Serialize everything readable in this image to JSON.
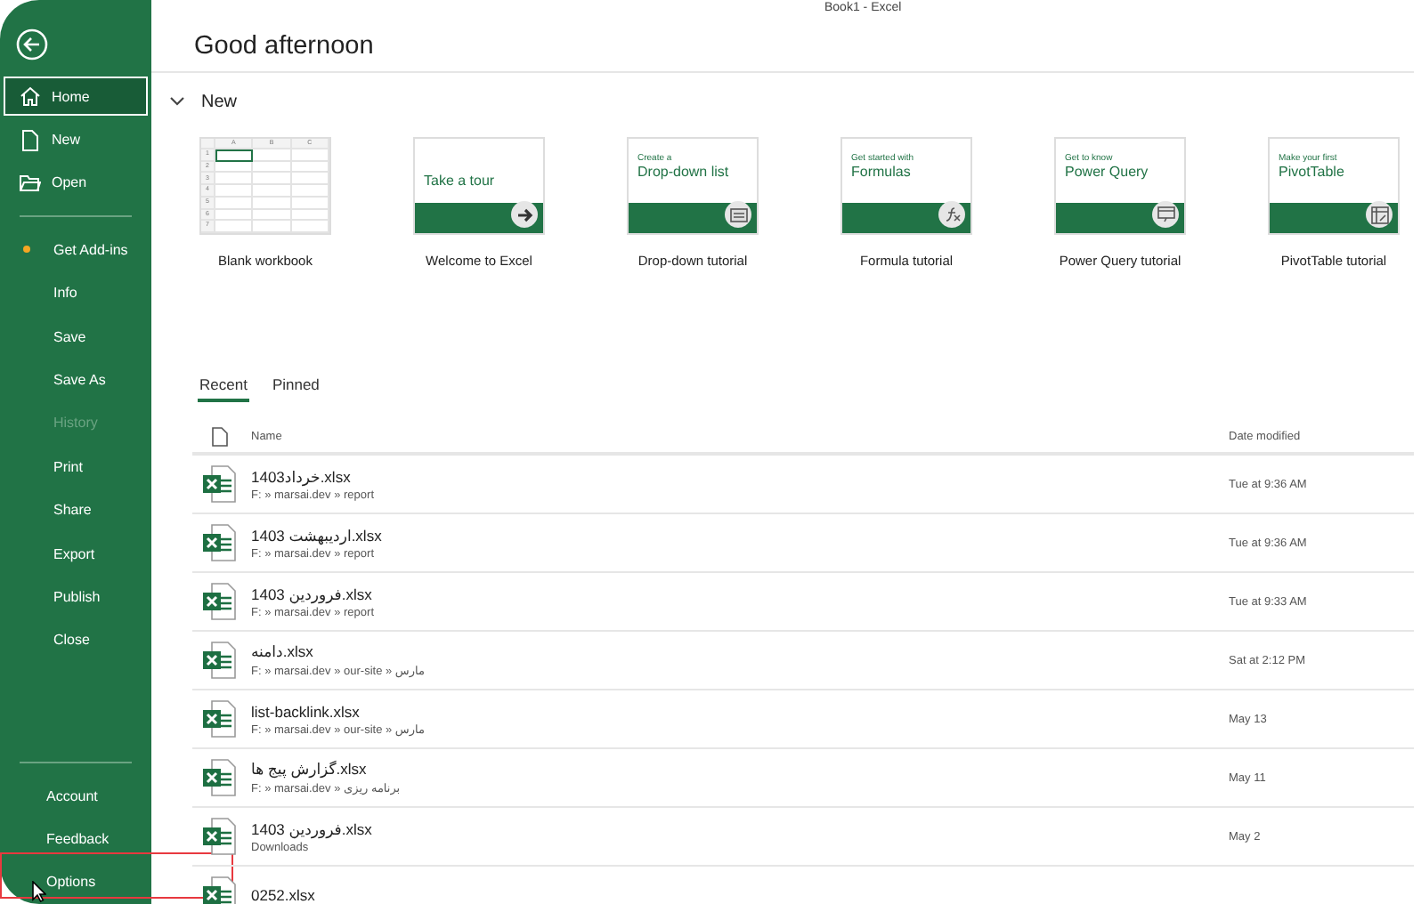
{
  "window": {
    "title": "Book1 - Excel"
  },
  "sidebar": {
    "top_items": [
      {
        "label": "Home",
        "selected": true,
        "disabled": false,
        "kind": "home"
      },
      {
        "label": "New",
        "selected": false,
        "disabled": false,
        "kind": "new"
      },
      {
        "label": "Open",
        "selected": false,
        "disabled": false,
        "kind": "open"
      }
    ],
    "middle_items": [
      {
        "label": "Get Add-ins",
        "selected": false,
        "disabled": false,
        "dot": true
      },
      {
        "label": "Info",
        "selected": false,
        "disabled": false,
        "dot": false
      },
      {
        "label": "Save",
        "selected": false,
        "disabled": false,
        "dot": false
      },
      {
        "label": "Save As",
        "selected": false,
        "disabled": false,
        "dot": false
      },
      {
        "label": "History",
        "selected": false,
        "disabled": true,
        "dot": false
      },
      {
        "label": "Print",
        "selected": false,
        "disabled": false,
        "dot": false
      },
      {
        "label": "Share",
        "selected": false,
        "disabled": false,
        "dot": false
      },
      {
        "label": "Export",
        "selected": false,
        "disabled": false,
        "dot": false
      },
      {
        "label": "Publish",
        "selected": false,
        "disabled": false,
        "dot": false
      },
      {
        "label": "Close",
        "selected": false,
        "disabled": false,
        "dot": false
      }
    ],
    "bottom_items": [
      {
        "label": "Account",
        "selected": false,
        "disabled": false,
        "highlighted": false
      },
      {
        "label": "Feedback",
        "selected": false,
        "disabled": false,
        "highlighted": false
      },
      {
        "label": "Options",
        "selected": false,
        "disabled": false,
        "highlighted": true
      }
    ]
  },
  "greeting": "Good afternoon",
  "new_section": {
    "title": "New",
    "templates": [
      {
        "kind": "blank",
        "label": "Blank workbook",
        "columns": [
          "A",
          "B",
          "C"
        ],
        "rows": [
          "1",
          "2",
          "3",
          "4",
          "5",
          "6",
          "7"
        ]
      },
      {
        "kind": "tour",
        "label": "Welcome to Excel",
        "heading": "Take a tour"
      },
      {
        "kind": "dropdown",
        "label": "Drop-down tutorial",
        "small": "Create a",
        "heading": "Drop-down list"
      },
      {
        "kind": "formula",
        "label": "Formula tutorial",
        "small": "Get started with",
        "heading": "Formulas"
      },
      {
        "kind": "query",
        "label": "Power Query tutorial",
        "small": "Get to know",
        "heading": "Power Query"
      },
      {
        "kind": "pivot",
        "label": "PivotTable tutorial",
        "small": "Make your first",
        "heading": "PivotTable"
      }
    ]
  },
  "tabs": [
    {
      "label": "Recent",
      "selected": true
    },
    {
      "label": "Pinned",
      "selected": false
    }
  ],
  "files": {
    "columns": [
      "Name",
      "Date modified"
    ],
    "rows": [
      {
        "name": "1403خرداد.xlsx",
        "path": "F: » marsai.dev » report",
        "date": "Tue at 9:36 AM"
      },
      {
        "name": "1403 اردیبهشت.xlsx",
        "path": "F: » marsai.dev » report",
        "date": "Tue at 9:36 AM"
      },
      {
        "name": "1403 فروردین.xlsx",
        "path": "F: » marsai.dev » report",
        "date": "Tue at 9:33 AM"
      },
      {
        "name": "دامنه.xlsx",
        "path": "F: » marsai.dev » our-site » مارس",
        "date": "Sat at 2:12 PM"
      },
      {
        "name": "list-backlink.xlsx",
        "path": "F: » marsai.dev » our-site » مارس",
        "date": "May 13"
      },
      {
        "name": "گزارش پیج ها.xlsx",
        "path": "F: » marsai.dev » برنامه ریزی",
        "date": "May 11"
      },
      {
        "name": "1403 فروردین.xlsx",
        "path": "Downloads",
        "date": "May 2"
      },
      {
        "name": "0252.xlsx"
      }
    ]
  }
}
